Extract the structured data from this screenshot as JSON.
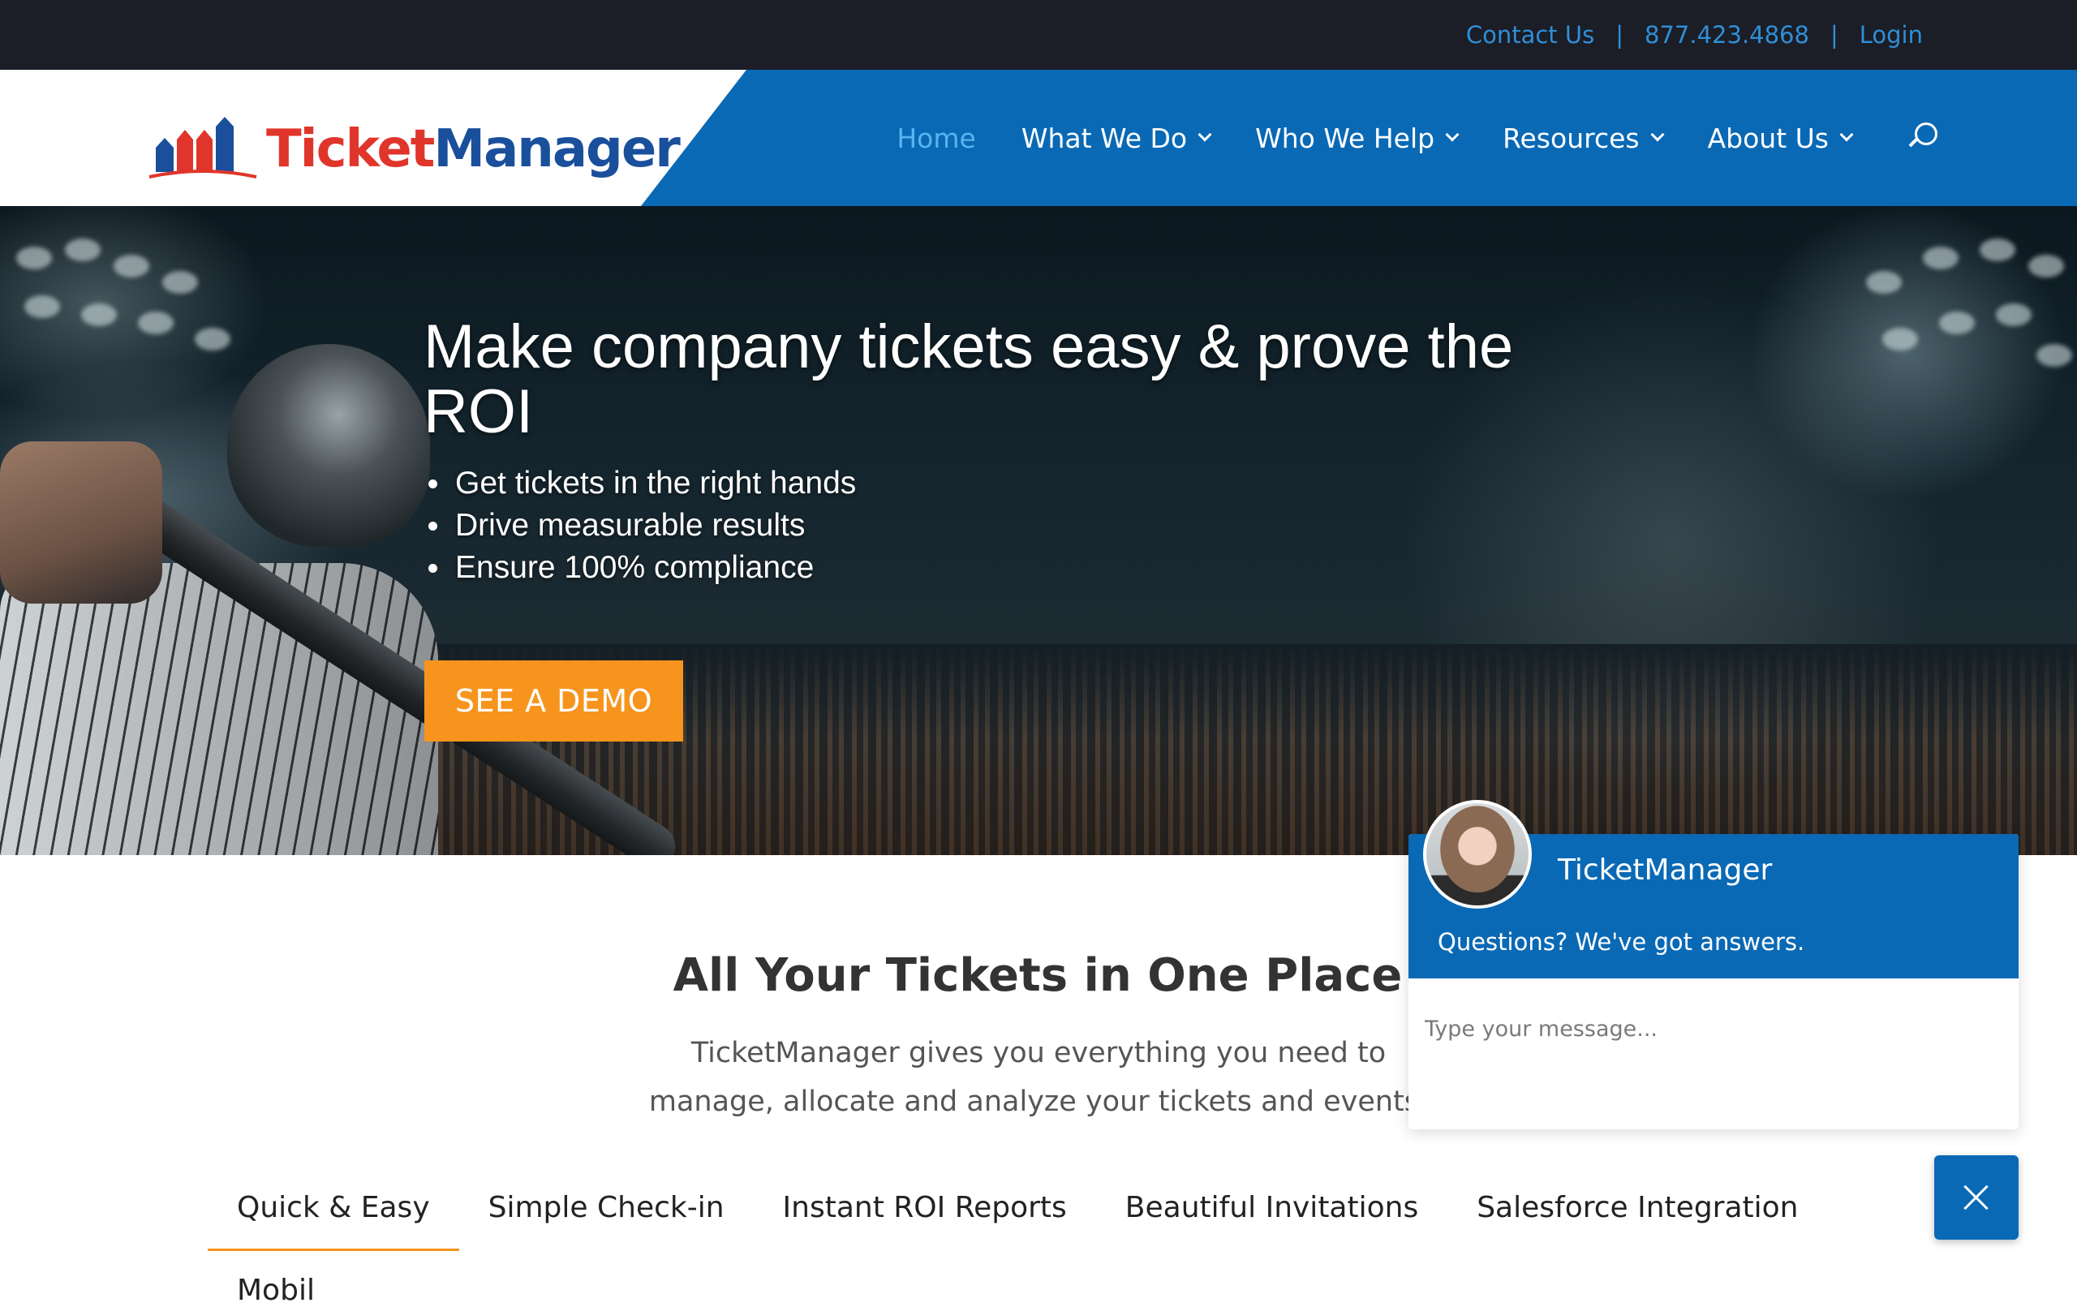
{
  "topbar": {
    "contact_label": "Contact Us",
    "separator": "|",
    "phone": "877.423.4868",
    "login_label": "Login"
  },
  "logo": {
    "part1": "Ticket",
    "part2": "Manager",
    "colors": {
      "red": "#e0352b",
      "blue": "#1a4f9c"
    }
  },
  "nav": {
    "items": [
      {
        "label": "Home",
        "active": true
      },
      {
        "label": "What We Do",
        "dropdown": true
      },
      {
        "label": "Who We Help",
        "dropdown": true
      },
      {
        "label": "Resources",
        "dropdown": true
      },
      {
        "label": "About Us",
        "dropdown": true
      }
    ],
    "search_icon": "search-icon"
  },
  "hero": {
    "title": "Make company tickets easy & prove the ROI",
    "bullets": [
      "Get tickets in the right hands",
      "Drive measurable results",
      "Ensure 100% compliance"
    ],
    "cta_label": "SEE A DEMO"
  },
  "section": {
    "title": "All Your Tickets in One Place",
    "subtitle": "TicketManager gives you everything you need to manage, allocate and analyze your tickets and events."
  },
  "tabs": {
    "items": [
      {
        "label": "Quick & Easy",
        "active": true
      },
      {
        "label": "Simple Check-in"
      },
      {
        "label": "Instant ROI Reports"
      },
      {
        "label": "Beautiful Invitations"
      },
      {
        "label": "Salesforce Integration"
      }
    ],
    "overflow_label": "Mobil"
  },
  "chat": {
    "agent_name": "TicketManager",
    "tagline": "Questions? We've got answers.",
    "input_placeholder": "Type your message...",
    "close_icon": "close-icon"
  },
  "colors": {
    "topbar_bg": "#1b1d27",
    "brand_blue": "#0a69b5",
    "link_blue": "#2f8fd6",
    "accent_orange": "#f7941d",
    "active_nav": "#56b4ef"
  }
}
